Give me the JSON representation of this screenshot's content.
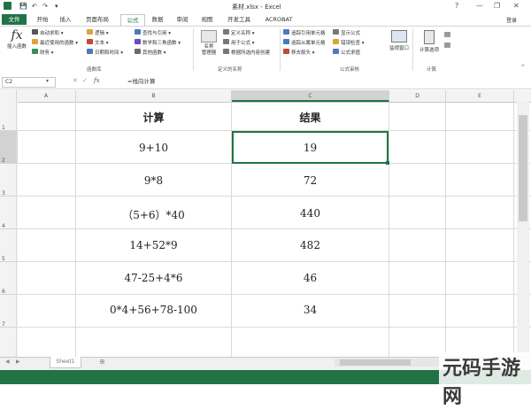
{
  "window": {
    "title": "素材.xlsx - Excel",
    "help": "?",
    "minimize": "—",
    "restore": "❐",
    "close": "✕",
    "user": "登录"
  },
  "tabs": [
    "文件",
    "开始",
    "插入",
    "页面布局",
    "公式",
    "数据",
    "审阅",
    "视图",
    "开发工具",
    "ACROBAT"
  ],
  "ribbon": {
    "insert_function": "插入函数",
    "library": [
      "自动求和 ▾",
      "最近使用的函数 ▾",
      "财务 ▾",
      "逻辑 ▾",
      "文本 ▾",
      "日期和时间 ▾",
      "查找与引用 ▾",
      "数学和三角函数 ▾",
      "其他函数 ▾"
    ],
    "library_group": "函数库",
    "name_manager": "名称\n管理器",
    "names": [
      "定义名称 ▾",
      "用于公式 ▾",
      "根据所选内容创建"
    ],
    "names_group": "定义的名称",
    "audit": [
      "追踪引用单元格",
      "追踪从属单元格",
      "移去箭头 ▾",
      "显示公式",
      "错误检查 ▾",
      "公式求值"
    ],
    "audit_group": "公式审核",
    "watch": "监视窗口",
    "calc_options": "计算选项",
    "calc_group": "计算"
  },
  "formula_bar": {
    "name_box": "C2",
    "fx": "fx",
    "content": "=栈向计算"
  },
  "columns": [
    "A",
    "B",
    "C",
    "D",
    "E"
  ],
  "rows": [
    "1",
    "2",
    "3",
    "4",
    "5",
    "6",
    "7"
  ],
  "table": {
    "header_calc": "计算",
    "header_result": "结果",
    "rows": [
      {
        "calc": "9+10",
        "result": "19"
      },
      {
        "calc": "9*8",
        "result": "72"
      },
      {
        "calc": "（5+6）*40",
        "result": "440"
      },
      {
        "calc": "14+52*9",
        "result": "482"
      },
      {
        "calc": "47-25+4*6",
        "result": "46"
      },
      {
        "calc": "0*4+56+78-100",
        "result": "34"
      }
    ]
  },
  "sheet": {
    "tab": "Sheet1",
    "add": "⊕"
  },
  "watermark": "元码手游网"
}
